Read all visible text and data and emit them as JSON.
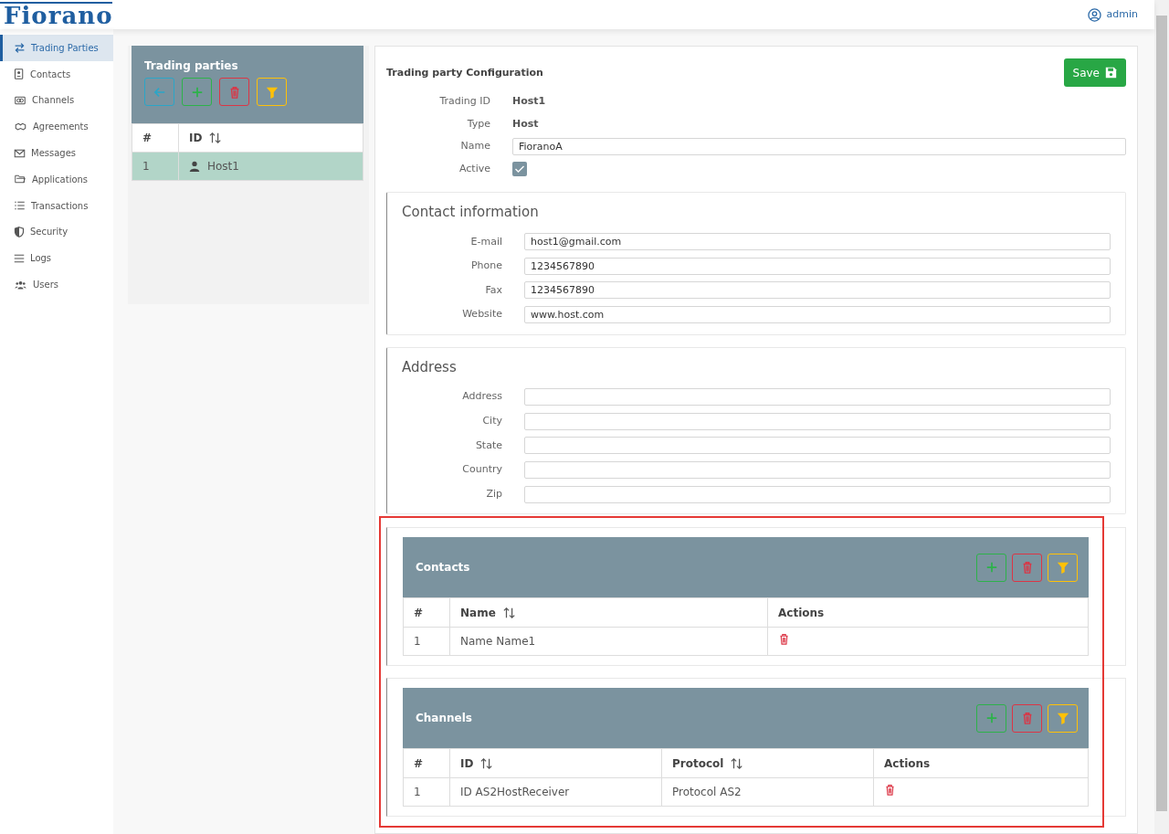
{
  "header": {
    "logo": "Fiorano",
    "user": "admin"
  },
  "sidebar": {
    "items": [
      {
        "label": "Trading Parties",
        "selected": true
      },
      {
        "label": "Contacts",
        "selected": false
      },
      {
        "label": "Channels",
        "selected": false
      },
      {
        "label": "Agreements",
        "selected": false
      },
      {
        "label": "Messages",
        "selected": false
      },
      {
        "label": "Applications",
        "selected": false
      },
      {
        "label": "Transactions",
        "selected": false
      },
      {
        "label": "Security",
        "selected": false
      },
      {
        "label": "Logs",
        "selected": false
      },
      {
        "label": "Users",
        "selected": false
      }
    ]
  },
  "trading_parties": {
    "title": "Trading parties",
    "columns": [
      {
        "label": "#",
        "sortable": false
      },
      {
        "label": "ID",
        "sortable": true
      }
    ],
    "rows": [
      {
        "number": "1",
        "id": "Host1",
        "selected": true
      }
    ]
  },
  "configuration": {
    "title": "Trading party Configuration",
    "save_label": "Save",
    "fields": [
      {
        "kind": "text",
        "label": "Trading ID",
        "value": "Host1"
      },
      {
        "kind": "text",
        "label": "Type",
        "value": "Host"
      },
      {
        "kind": "input",
        "label": "Name",
        "value": "FioranoA"
      },
      {
        "kind": "checkbox",
        "label": "Active",
        "checked": true
      }
    ]
  },
  "contact_information": {
    "title": "Contact information",
    "fields": [
      {
        "label": "E-mail",
        "value": "host1@gmail.com"
      },
      {
        "label": "Phone",
        "value": "1234567890"
      },
      {
        "label": "Fax",
        "value": "1234567890"
      },
      {
        "label": "Website",
        "value": "www.host.com"
      }
    ]
  },
  "address": {
    "title": "Address",
    "fields": [
      {
        "label": "Address"
      },
      {
        "label": "City"
      },
      {
        "label": "State"
      },
      {
        "label": "Country"
      },
      {
        "label": "Zip"
      }
    ]
  },
  "contacts": {
    "title": "Contacts",
    "columns": [
      {
        "label": "#",
        "sortable": false
      },
      {
        "label": "Name",
        "sortable": true
      },
      {
        "label": "Actions",
        "sortable": false
      }
    ],
    "rows": [
      {
        "cells": [
          "1",
          "Name Name1"
        ]
      }
    ]
  },
  "channels": {
    "title": "Channels",
    "columns": [
      {
        "label": "#",
        "sortable": false
      },
      {
        "label": "ID",
        "sortable": true
      },
      {
        "label": "Protocol",
        "sortable": true
      },
      {
        "label": "Actions",
        "sortable": false
      }
    ],
    "rows": [
      {
        "cells": [
          "1",
          "ID AS2HostReceiver",
          "Protocol AS2"
        ]
      }
    ]
  }
}
